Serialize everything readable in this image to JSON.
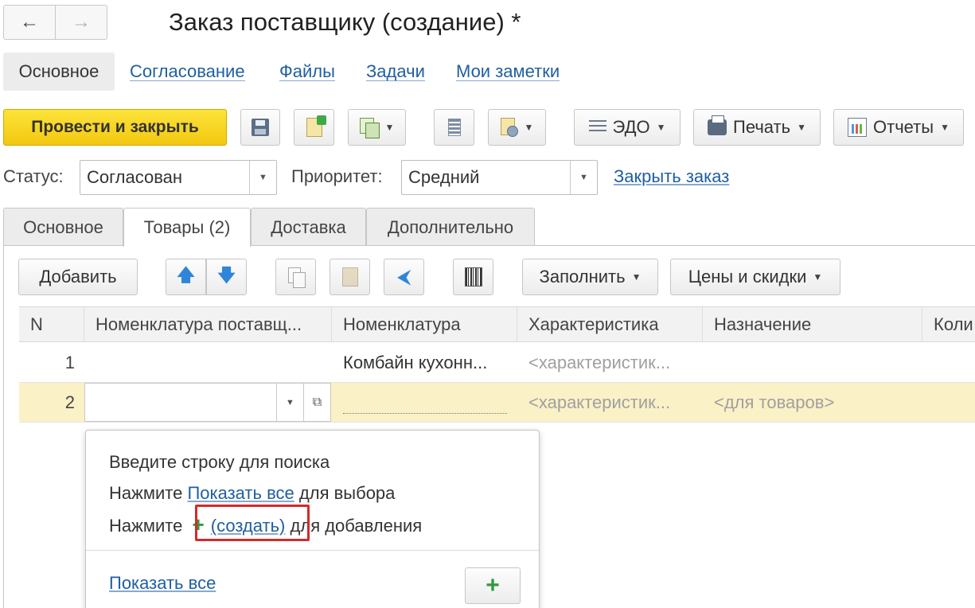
{
  "window": {
    "back_icon": "arrow-left-icon",
    "forward_icon": "arrow-right-icon",
    "title": "Заказ поставщику (создание) *"
  },
  "section_tabs": [
    {
      "label": "Основное",
      "active": true
    },
    {
      "label": "Согласование"
    },
    {
      "label": "Файлы"
    },
    {
      "label": "Задачи"
    },
    {
      "label": "Мои заметки"
    }
  ],
  "toolbar": {
    "post_close_label": "Провести и закрыть",
    "edo_label": "ЭДО",
    "print_label": "Печать",
    "reports_label": "Отчеты",
    "icons": [
      "save-icon",
      "post-icon",
      "create-based-on-icon",
      "structure-icon",
      "attachments-icon"
    ]
  },
  "status": {
    "status_label": "Статус:",
    "status_value": "Согласован",
    "priority_label": "Приоритет:",
    "priority_value": "Средний",
    "close_order_link": "Закрыть заказ"
  },
  "page_tabs": [
    {
      "label": "Основное"
    },
    {
      "label": "Товары (2)",
      "active": true
    },
    {
      "label": "Доставка"
    },
    {
      "label": "Дополнительно"
    }
  ],
  "goods_toolbar": {
    "add_label": "Добавить",
    "fill_label": "Заполнить",
    "prices_label": "Цены и скидки"
  },
  "table": {
    "columns": [
      "N",
      "Номенклатура поставщ...",
      "Номенклатура",
      "Характеристика",
      "Назначение",
      "Коли"
    ],
    "rows": [
      {
        "n": "1",
        "supplier_item": "",
        "item": "Комбайн кухонн...",
        "characteristic": "<характеристик...",
        "purpose": ""
      },
      {
        "n": "2",
        "supplier_item": "",
        "item": "",
        "characteristic": "<характеристик...",
        "purpose": "<для товаров>"
      }
    ]
  },
  "popup": {
    "line1": "Введите строку для поиска",
    "line2_prefix": "Нажмите",
    "line2_link": "Показать все",
    "line2_suffix": "для выбора",
    "line3_prefix": "Нажмите",
    "line3_plus": "+",
    "line3_link": "(создать)",
    "line3_suffix": "для добавления",
    "show_all_link": "Показать все",
    "add_button": "+"
  },
  "colors": {
    "primary_button": "#f2c810",
    "link": "#1f5fa0",
    "selected_row": "#fbf1c6",
    "highlight_box": "#d42a2a",
    "create_plus": "#2e9a3f"
  }
}
